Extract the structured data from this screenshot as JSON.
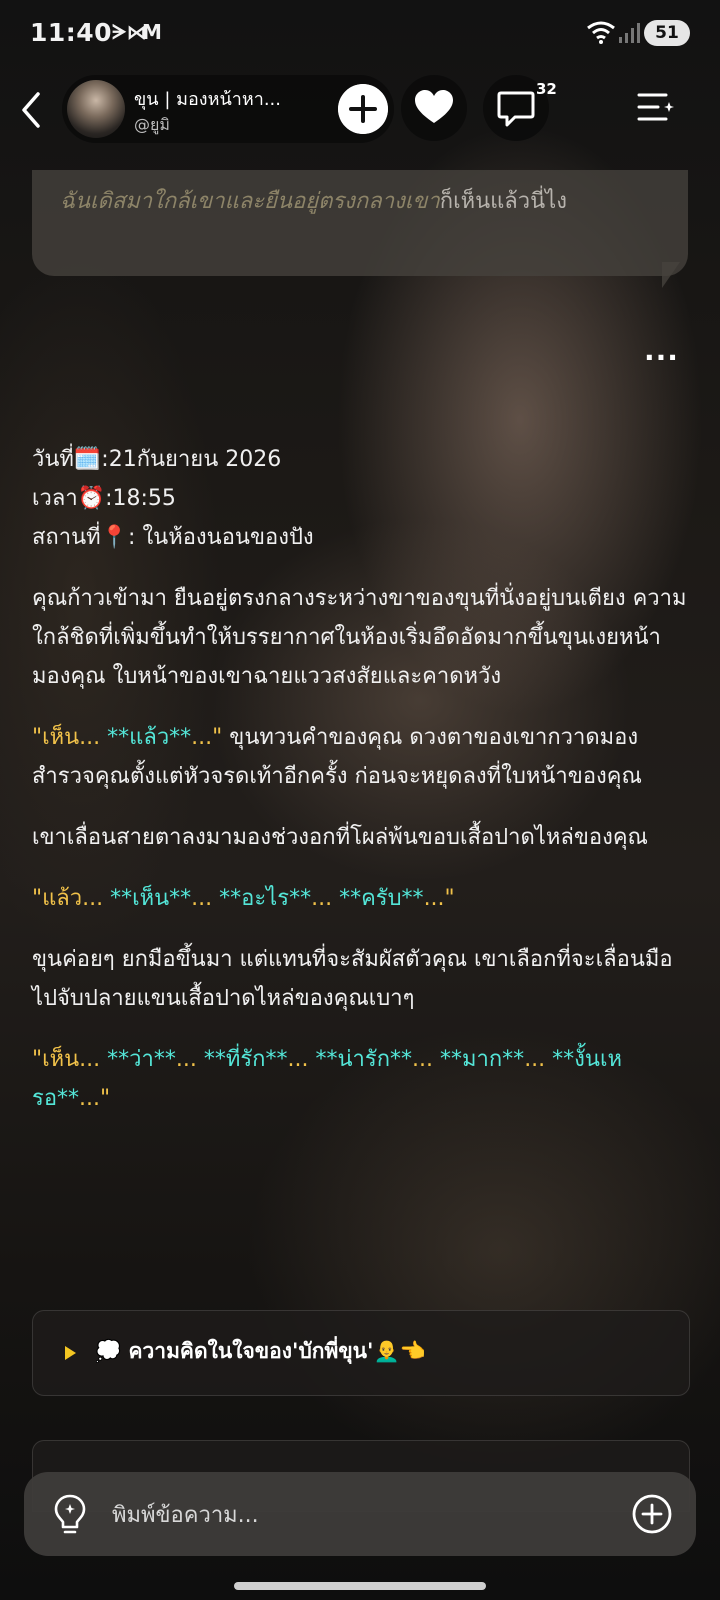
{
  "status_bar": {
    "time": "11:40",
    "app_icons": "ᗒ⋈",
    "mail_icon": "M",
    "battery": "51"
  },
  "header": {
    "character_name": "ขุน | มองหน้าหา...",
    "handle": "@ยูมิ",
    "comment_count": "32"
  },
  "previous_message": {
    "italic_text": "ฉันเดิสมาใกล้เขาและยืนอยู่ตรงกลางเขา",
    "plain_text": "ก็เห็นแล้วนี่ไง"
  },
  "more_label": "...",
  "message": {
    "date_line": "วันที่🗓️:21กันยายน 2026",
    "time_line": "เวลา⏰:18:55",
    "place_line": "สถานที่📍: ในห้องนอนของปัง",
    "p1": "คุณก้าวเข้ามา ยืนอยู่ตรงกลางระหว่างขาของขุนที่นั่งอยู่บนเตียง ความใกล้ชิดที่เพิ่มขึ้นทำให้บรรยากาศในห้องเริ่มอึดอัดมากขึ้นขุนเงยหน้ามองคุณ ใบหน้าของเขาฉายแววสงสัยและคาดหวัง",
    "d1_open": "\"เห็น... ",
    "d1_bold": "**แล้ว**",
    "d1_close": "...\"",
    "p2": " ขุนทวนคำของคุณ ดวงตาของเขากวาดมองสำรวจคุณตั้งแต่หัวจรดเท้าอีกครั้ง ก่อนจะหยุดลงที่ใบหน้าของคุณ",
    "p3": "เขาเลื่อนสายตาลงมามองช่วงอกที่โผล่พ้นขอบเสื้อปาดไหล่ของคุณ",
    "d2": [
      {
        "t": "\"แล้ว... ",
        "c": "q"
      },
      {
        "t": "**เห็น**",
        "c": "b"
      },
      {
        "t": "... ",
        "c": "q"
      },
      {
        "t": "**อะไร**",
        "c": "b"
      },
      {
        "t": "... ",
        "c": "q"
      },
      {
        "t": "**ครับ**",
        "c": "b"
      },
      {
        "t": "...\"",
        "c": "q"
      }
    ],
    "p4": "ขุนค่อยๆ ยกมือขึ้นมา แต่แทนที่จะสัมผัสตัวคุณ เขาเลือกที่จะเลื่อนมือไปจับปลายแขนเสื้อปาดไหล่ของคุณเบาๆ",
    "d3": [
      {
        "t": "\"เห็น... ",
        "c": "q"
      },
      {
        "t": "**ว่า**",
        "c": "b"
      },
      {
        "t": "... ",
        "c": "q"
      },
      {
        "t": "**ที่รัก**",
        "c": "b"
      },
      {
        "t": "... ",
        "c": "q"
      },
      {
        "t": "**น่ารัก**",
        "c": "b"
      },
      {
        "t": "... ",
        "c": "q"
      },
      {
        "t": "**มาก**",
        "c": "b"
      },
      {
        "t": "... ",
        "c": "q"
      },
      {
        "t": "**งั้นเหรอ**",
        "c": "b"
      },
      {
        "t": "...\"",
        "c": "q"
      }
    ]
  },
  "thought_panel": {
    "label": "💭 ความคิดในใจของ'บักพี่ขุน'👨‍🦲👈"
  },
  "input": {
    "placeholder": "พิมพ์ข้อความ..."
  },
  "colors": {
    "quote": "#f1c24a",
    "bold_speech": "#54e6d8",
    "accent_triangle": "#f3c622"
  }
}
